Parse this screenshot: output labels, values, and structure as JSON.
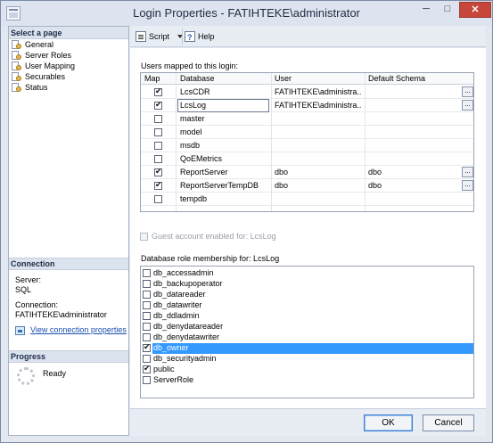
{
  "window": {
    "title": "Login Properties - FATIHTEKE\\administrator",
    "controls": {
      "minimize": "─",
      "maximize": "□",
      "close": "✕"
    }
  },
  "sidebar": {
    "header": "Select a page",
    "pages": [
      {
        "label": "General",
        "icon": "page-settings-icon"
      },
      {
        "label": "Server Roles",
        "icon": "page-settings-icon"
      },
      {
        "label": "User Mapping",
        "icon": "page-settings-icon"
      },
      {
        "label": "Securables",
        "icon": "page-settings-icon"
      },
      {
        "label": "Status",
        "icon": "page-settings-icon"
      }
    ],
    "connection": {
      "header": "Connection",
      "server_label": "Server:",
      "server_value": "SQL",
      "connection_label": "Connection:",
      "connection_value": "FATIHTEKE\\administrator",
      "view_link": "View connection properties"
    },
    "progress": {
      "header": "Progress",
      "status": "Ready"
    }
  },
  "toolbar": {
    "script_label": "Script",
    "help_label": "Help"
  },
  "users_mapped": {
    "caption": "Users mapped to this login:",
    "columns": [
      "Map",
      "Database",
      "User",
      "Default Schema"
    ],
    "rows": [
      {
        "checked": true,
        "database": "LcsCDR",
        "user": "FATIHTEKE\\administra...",
        "schema": "",
        "ellipsis": "..."
      },
      {
        "checked": true,
        "database": "LcsLog",
        "user": "FATIHTEKE\\administra...",
        "schema": "",
        "ellipsis": "..."
      },
      {
        "checked": false,
        "database": "master",
        "user": "",
        "schema": "",
        "ellipsis": ""
      },
      {
        "checked": false,
        "database": "model",
        "user": "",
        "schema": "",
        "ellipsis": ""
      },
      {
        "checked": false,
        "database": "msdb",
        "user": "",
        "schema": "",
        "ellipsis": ""
      },
      {
        "checked": false,
        "database": "QoEMetrics",
        "user": "",
        "schema": "",
        "ellipsis": ""
      },
      {
        "checked": true,
        "database": "ReportServer",
        "user": "dbo",
        "schema": "dbo",
        "ellipsis": "..."
      },
      {
        "checked": true,
        "database": "ReportServerTempDB",
        "user": "dbo",
        "schema": "dbo",
        "ellipsis": "..."
      },
      {
        "checked": false,
        "database": "tempdb",
        "user": "",
        "schema": "",
        "ellipsis": ""
      }
    ]
  },
  "guest": {
    "label": "Guest account enabled for: LcsLog",
    "checked": false
  },
  "roles": {
    "caption": "Database role membership for: LcsLog",
    "items": [
      {
        "name": "db_accessadmin",
        "checked": false
      },
      {
        "name": "db_backupoperator",
        "checked": false
      },
      {
        "name": "db_datareader",
        "checked": false
      },
      {
        "name": "db_datawriter",
        "checked": false
      },
      {
        "name": "db_ddladmin",
        "checked": false
      },
      {
        "name": "db_denydatareader",
        "checked": false
      },
      {
        "name": "db_denydatawriter",
        "checked": false
      },
      {
        "name": "db_owner",
        "checked": true,
        "selected": true
      },
      {
        "name": "db_securityadmin",
        "checked": false
      },
      {
        "name": "public",
        "checked": true
      },
      {
        "name": "ServerRole",
        "checked": false
      }
    ]
  },
  "buttons": {
    "ok": "OK",
    "cancel": "Cancel"
  }
}
